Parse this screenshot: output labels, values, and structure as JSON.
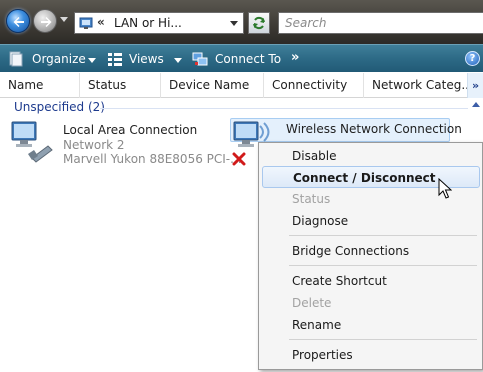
{
  "addressbar": {
    "back_icon": "back-arrow-icon",
    "forward_icon": "forward-arrow-icon",
    "breadcrumb_chevron": "«",
    "path": "LAN or Hi...",
    "search_placeholder": "Search"
  },
  "toolbar": {
    "organize_label": "Organize",
    "views_label": "Views",
    "connect_to_label": "Connect To",
    "more_label": "»",
    "help_label": "?"
  },
  "columns": [
    "Name",
    "Status",
    "Device Name",
    "Connectivity",
    "Network Categ..."
  ],
  "columns_more": "»",
  "group": {
    "label": "Unspecified (2)"
  },
  "connections": [
    {
      "name": "Local Area Connection",
      "network": "Network  2",
      "device": "Marvell Yukon 88E8056 PCI-..."
    },
    {
      "name": "Wireless Network Connection",
      "status_icon": "red-x-disconnected-icon"
    }
  ],
  "context_menu": {
    "items": [
      {
        "label": "Disable",
        "enabled": true
      },
      {
        "label": "Connect / Disconnect",
        "enabled": true,
        "default": true,
        "hovered": true
      },
      {
        "label": "Status",
        "enabled": false
      },
      {
        "label": "Diagnose",
        "enabled": true
      },
      {
        "label": "Bridge Connections",
        "enabled": true
      },
      {
        "label": "Create Shortcut",
        "enabled": true
      },
      {
        "label": "Delete",
        "enabled": false
      },
      {
        "label": "Rename",
        "enabled": true
      },
      {
        "label": "Properties",
        "enabled": true
      }
    ]
  },
  "colors": {
    "toolbar": "#2d6a86",
    "group_header": "#1e3b8e",
    "selection": "#e4f0fc",
    "disabled_text": "#a2a2a2"
  }
}
